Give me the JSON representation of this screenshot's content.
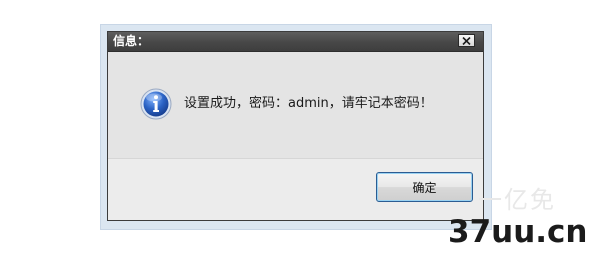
{
  "dialog": {
    "title": "信息：",
    "message": "设置成功，密码：admin，请牢记本密码！",
    "ok_label": "确定",
    "close_glyph": "✕"
  },
  "icons": {
    "close": "close-icon",
    "info": "info-icon"
  },
  "watermark": {
    "text": "37uu.cn",
    "faint_text": "一亿免"
  },
  "colors": {
    "titlebar": "#474747",
    "dialog_bg": "#e4e4e4",
    "icon_blue": "#2a62c4",
    "button_border": "#2b5c92"
  }
}
